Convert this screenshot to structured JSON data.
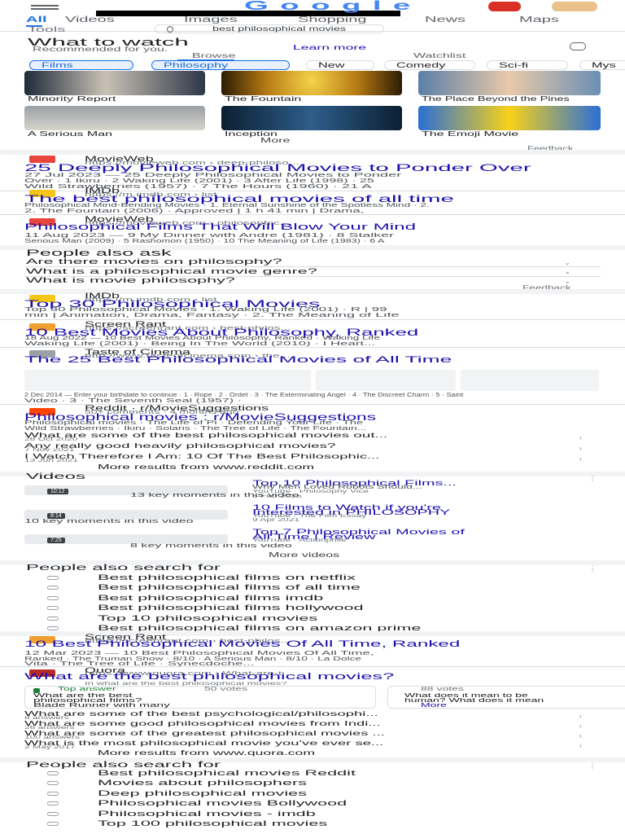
{
  "header": {
    "logo_text": "Google",
    "avatar_label": "avatar"
  },
  "tabs": [
    "All",
    "Videos",
    "Images",
    "Shopping",
    "News",
    "Maps"
  ],
  "filters_left": "Tools",
  "search_query": "best philosophical movies",
  "what_to_watch": {
    "title": "What to watch",
    "subtitle": "Recommended for you.",
    "learn_more": "Learn more",
    "browse": "Browse",
    "watchlist": "Watchlist",
    "chips": [
      "Films",
      "Philosophy",
      "New",
      "Comedy",
      "Sci-fi",
      "Mys"
    ],
    "movies": [
      {
        "caption": "Minority Report"
      },
      {
        "caption": "The Fountain"
      },
      {
        "caption": "The Place Beyond the Pines"
      },
      {
        "caption": "A Serious Man"
      },
      {
        "caption": "Inception"
      },
      {
        "caption": "The Emoji Movie"
      }
    ],
    "more": "More",
    "feedback": "Feedback"
  },
  "results_a": [
    {
      "source": "MovieWeb",
      "url": "https://movieweb.com › deep-philoso...",
      "title": "25 Deeply Philosophical Movies to Ponder Over",
      "snippet_1": "27 Jul 2023 — 25 Deeply Philosophical Movies to Ponder",
      "snippet_2": "Over · 1 Ikiru · 2 Waking Life (2001) · 3 After Life (1998) · 25",
      "snippet_3": "Wild Strawberries (1957) · 7 The Hours (1960) · 21 A",
      "fav_color": "#e8453c"
    },
    {
      "source": "IMDb",
      "url": "https://m.imdb.com › list",
      "title": "The best philosophical movies of all time",
      "snippet_1": "Philosophical Mind-Bending Movies · 1. Eternal Sunshine of the Spotless Mind · 2.",
      "snippet_2": "2. The Fountain (2006) · Approved | 1 h 41 min | Drama,",
      "snippet_3": "",
      "fav_color": "#f5c518"
    },
    {
      "source": "MovieWeb",
      "url": "https://movieweb.com › philosophic...",
      "title": "Philosophical Films That Will Blow Your Mind",
      "snippet_1": "11 Aug 2023 — 9 My Dinner with Andre (1981) · 8 Stalker",
      "snippet_2": "Serious Man (2009) · 5 Rashomon (1950) · 10 The Meaning of Life (1983) · 6 A",
      "snippet_3": "",
      "fav_color": "#e8453c"
    }
  ],
  "paa_1": {
    "title": "People also ask",
    "questions": [
      "Are there movies on philosophy?",
      "What is a philosophical movie genre?",
      "What is movie philosophy?"
    ],
    "feedback": "Feedback"
  },
  "results_b": [
    {
      "source": "IMDb",
      "url": "https://m.imdb.com › list",
      "title": "Top 30 Philosophical Movies",
      "snippet_1": "Top 30 Philosophical Movies · 1. Waking Life (2001) · R | 99",
      "snippet_2": "min | Animation, Drama, Fantasy · 2. The Meaning of Life",
      "fav_color": "#f5c518"
    },
    {
      "source": "Screen Rant",
      "url": "https://screenrant.com › best-philos...",
      "title": "10 Best Movies About Philosophy, Ranked",
      "snippet_1": "18 Aug 2022 — 10 Best Movies About Philosophy, Ranked · Waking Life",
      "snippet_2": "Waking Life (2001) · Being In The World (2010) · I Heart...",
      "fav_color": "#f0a030"
    },
    {
      "source": "Taste of Cinema",
      "url": "http://www.tasteofcinema.com › the...",
      "title": "The 25 Best Philosophical Movies of All Time",
      "snippet_1": "",
      "snippet_2": "",
      "fav_color": "#9aa0a6"
    }
  ],
  "reddit": {
    "snippet": "2 Dec 2014 — Enter your birthdate to continue · 1 · Rope · 2 · Ordet · 3 · The Exterminating Angel · 4 · The Discreet Charm · 5 · Saint",
    "snippet_b": "Video · 3 · The Seventh Seal (1957) ·",
    "source": "Reddit · r/MovieSuggestions",
    "url": "50+ comments · 4 months ago",
    "title": "Philosophical movies : r/MovieSuggestions",
    "s1": "Philosophical movies · The Life of Pi · Defending Your Life · The",
    "s2": "Wild Strawberries · Ikiru · Solaris · The Tree of Life · The Fountain...",
    "q1": "What are some of the best philosophical movies out...",
    "q1d": "26 Oct 2020",
    "q2": "Any really good heavily philosophical movies?",
    "q2d": "7 Nov 2021",
    "q3": "I Watch Therefore I Am: 10 Of The Best Philosophic...",
    "q3d": "13 Jun 2021",
    "more": "More results from www.reddit.com"
  },
  "videos": {
    "title": "Videos",
    "items": [
      {
        "title": "Top 10 Philosophical Films...",
        "meta": "Why Men Loved Robots Should...",
        "meta2": "YouTube · Philosophy Vice",
        "date": "5 Feb 2025",
        "duration": "10:12",
        "moments": "13 key moments in this video"
      },
      {
        "title": "10 Films to Watch if you're",
        "meta": "Interested in PHILOSOPHY",
        "meta2": "YouTube · The Film Essay",
        "date": "9 Apr 2021",
        "duration": "8:14",
        "moments": "10 key moments in this video"
      },
      {
        "title": "Top 7 Philosophical Movies of",
        "meta": "All Time | Review",
        "meta2": "YouTube · Actionphile",
        "date": "",
        "duration": "7:25",
        "moments": "8 key moments in this video"
      }
    ],
    "more": "More videos"
  },
  "pass_1": {
    "title": "People also search for",
    "items": [
      "Best philosophical films on netflix",
      "Best philosophical films of all time",
      "Best philosophical films imdb",
      "Best philosophical films hollywood",
      "Top 10 philosophical movies",
      "Best philosophical films on amazon prime"
    ]
  },
  "results_c": [
    {
      "source": "Screen Rant",
      "url": "https://screenrant.com › best-philos...",
      "title": "10 Best Philosophical Movies Of All Time, Ranked",
      "snippet_1": "12 Mar 2023 — 10 Best Philosophical Movies Of All Time,",
      "snippet_2": "Ranked · The Truman Show · 8/10 · A Serious Man · 8/10 · La Dolce",
      "snippet_3": "Vita · The Tree of Life · Synecdoche...",
      "fav_color": "#f0a030"
    }
  ],
  "quora": {
    "source": "Quora",
    "url": "https://www.quora.com › What-are-t...",
    "title": "What are the best philosophical movies?",
    "sub": "In what are the best philosophical movies?",
    "answer_badge": "Top answer",
    "answer_votes": "50 votes",
    "answer_1": "What are the best",
    "answer_2": "philosophical films?",
    "answer_3": "Blade Runner with many",
    "right_votes": "88 votes",
    "right_1": "What does it mean to be",
    "right_2": "human? What does it mean",
    "more": "More",
    "q1": "What are some of the best psychological/philosophi...",
    "q1d": "8 answers",
    "q2": "What are some good philosophical movies from Indi...",
    "q2d": "26 answers",
    "q3": "What are some of the greatest philosophical movies ...",
    "q3d": "100 answers",
    "q4": "What is the most philosophical movie you've ever se...",
    "q4d": "2 May 2017",
    "more_results": "More results from www.quora.com"
  },
  "pass_2": {
    "title": "People also search for",
    "items": [
      "Best philosophical movies Reddit",
      "Movies about philosophers",
      "Deep philosophical movies",
      "Philosophical movies Bollywood",
      "Philosophical movies - imdb",
      "Top 100 philosophical movies"
    ]
  },
  "colors": {
    "link": "#1a0dab",
    "muted": "#70757a",
    "chip_active_bg": "#e8f0fe",
    "answer_green": "#188038"
  },
  "icons": {
    "search": "magnifier-icon",
    "chevron": "chevron-down-icon",
    "menu": "hamburger-icon"
  }
}
